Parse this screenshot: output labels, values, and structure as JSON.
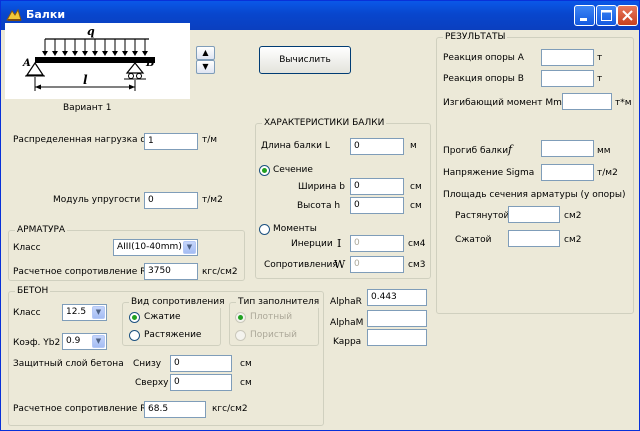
{
  "window": {
    "title": "Балки"
  },
  "beam": {
    "image_caption": "Вариант 1",
    "calc_button": "Вычислить",
    "spin_up": "▲",
    "spin_down": "▼",
    "label_q": "q",
    "label_A": "A",
    "label_B": "B",
    "label_l": "l"
  },
  "load": {
    "dist_label": "Распределенная нагрузка  q",
    "dist_value": "1",
    "dist_unit": "т/м",
    "modulus_label": "Модуль упругости  E",
    "modulus_value": "0",
    "modulus_unit": "т/м2"
  },
  "beam_props": {
    "group_title": "ХАРАКТЕРИСТИКИ БАЛКИ",
    "length_label": "Длина  балки  L",
    "length_value": "0",
    "length_unit": "м",
    "section_label": "Сечение",
    "width_label": "Ширина  b",
    "width_value": "0",
    "width_unit": "см",
    "height_label": "Высота  h",
    "height_value": "0",
    "height_unit": "см",
    "moments_label": "Моменты",
    "inertia_label": "Инерции",
    "inertia_sym": "I",
    "inertia_value": "0",
    "inertia_unit": "см4",
    "resist_label": "Сопротивления",
    "resist_sym": "W",
    "resist_value": "0",
    "resist_unit": "см3"
  },
  "rebar": {
    "group_title": "АРМАТУРА",
    "class_label": "Класс",
    "class_value": "AIII(10-40mm)",
    "rs_label": "Расчетное сопротивление Rs",
    "rs_value": "3750",
    "rs_unit": "кгс/см2"
  },
  "concrete": {
    "group_title": "БЕТОН",
    "class_label": "Класс",
    "class_value": "12.5",
    "yb2_label": "Коэф. Yb2",
    "yb2_value": "0.9",
    "resist_type_title": "Вид сопротивления",
    "compression": "Сжатие",
    "tension": "Растяжение",
    "filler_title": "Тип заполнителя",
    "dense": "Плотный",
    "porous": "Пористый",
    "cover_label": "Защитный слой бетона",
    "bottom_label": "Снизу",
    "bottom_value": "0",
    "bottom_unit": "см",
    "top_label": "Сверху",
    "top_value": "0",
    "top_unit": "см",
    "rb_label": "Расчетное сопротивление Rb",
    "rb_value": "68.5",
    "rb_unit": "кгс/см2"
  },
  "alpha": {
    "alphaR_label": "AlphaR",
    "alphaR_value": "0.443",
    "alphaM_label": "AlphaM",
    "alphaM_value": "",
    "kappa_label": "Kappa",
    "kappa_value": ""
  },
  "results": {
    "group_title": "РЕЗУЛЬТАТЫ",
    "reactionA_label": "Реакция опоры A",
    "reactionA_unit": "т",
    "reactionB_label": "Реакция опоры B",
    "reactionB_unit": "т",
    "moment_label": "Изгибающий момент Mmax",
    "moment_unit": "т*м",
    "deflection_label": "Прогиб балки",
    "deflection_sym": "f",
    "deflection_unit": "мм",
    "stress_label": "Напряжение Sigma",
    "stress_unit": "т/м2",
    "area_label": "Площадь сечения арматуры (у опоры)",
    "tension_label": "Растянутой",
    "tension_unit": "см2",
    "compress_label": "Сжатой",
    "compress_unit": "см2"
  }
}
